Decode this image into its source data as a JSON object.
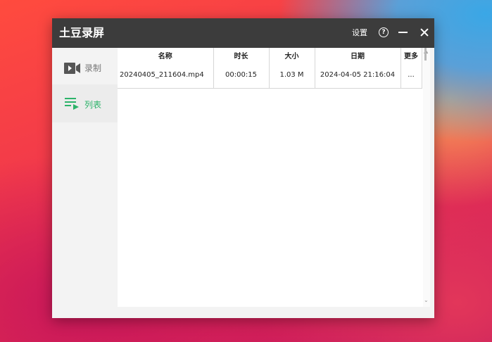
{
  "window": {
    "title": "土豆录屏",
    "settings_label": "设置",
    "help_label": "?"
  },
  "sidebar": {
    "items": [
      {
        "label": "录制",
        "icon": "video-camera-icon",
        "active": false
      },
      {
        "label": "列表",
        "icon": "list-play-icon",
        "active": true
      }
    ]
  },
  "table": {
    "headers": [
      "名称",
      "时长",
      "大小",
      "日期",
      "更多"
    ],
    "rows": [
      {
        "name": "20240405_211604.mp4",
        "duration": "00:00:15",
        "size": "1.03 M",
        "date": "2024-04-05 21:16:04",
        "more": "..."
      }
    ]
  },
  "colors": {
    "titlebar": "#3c3c3c",
    "accent": "#2db36a"
  }
}
